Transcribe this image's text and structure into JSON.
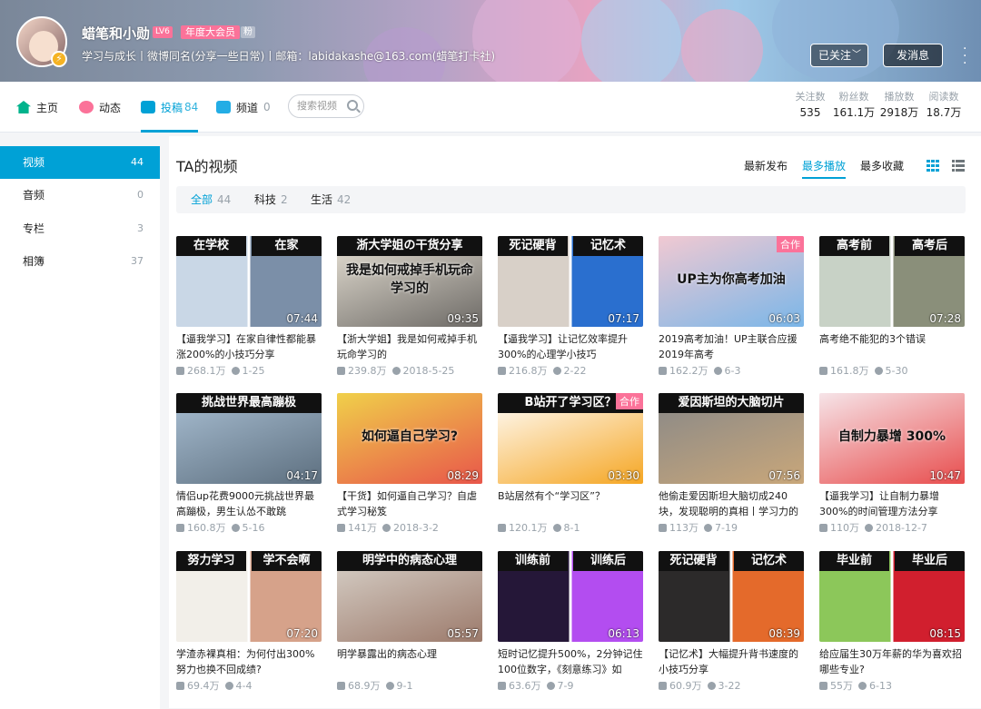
{
  "profile": {
    "name": "蜡笔和小勋",
    "level": "LV6",
    "vip": "年度大会员",
    "fan_tag": "粉",
    "sign": "学习与成长丨微博同名(分享一些日常)丨邮箱：labidakashe@163.com(蜡笔打卡社)",
    "follow_label": "已关注",
    "msg_label": "发消息"
  },
  "nav": {
    "home": "主页",
    "dynamic": "动态",
    "upload": "投稿",
    "upload_count": "84",
    "channel": "频道",
    "channel_count": "0",
    "search_placeholder": "搜索视频"
  },
  "stats": [
    {
      "label": "关注数",
      "value": "535"
    },
    {
      "label": "粉丝数",
      "value": "161.1万"
    },
    {
      "label": "播放数",
      "value": "2918万"
    },
    {
      "label": "阅读数",
      "value": "18.7万"
    }
  ],
  "sidebar": [
    {
      "label": "视频",
      "count": "44"
    },
    {
      "label": "音频",
      "count": "0"
    },
    {
      "label": "专栏",
      "count": "3"
    },
    {
      "label": "相簿",
      "count": "37"
    }
  ],
  "section_title": "TA的视频",
  "sort": [
    "最新发布",
    "最多播放",
    "最多收藏"
  ],
  "filters": [
    {
      "label": "全部",
      "count": "44"
    },
    {
      "label": "科技",
      "count": "2"
    },
    {
      "label": "生活",
      "count": "42"
    }
  ],
  "videos": [
    {
      "cap_l": "在学校",
      "cap_r": "在家",
      "dur": "07:44",
      "title": "【逼我学习】在家自律性都能暴涨200%的小技巧分享",
      "plays": "268.1万",
      "date": "1-25"
    },
    {
      "cap": "浙大学姐の干货分享",
      "sub": "我是如何戒掉手机玩命学习的",
      "dur": "09:35",
      "title": "【浙大学姐】我是如何戒掉手机玩命学习的",
      "plays": "239.8万",
      "date": "2018-5-25"
    },
    {
      "cap_l": "死记硬背",
      "cap_r": "记忆术",
      "dur": "07:17",
      "title": "【逼我学习】让记忆效率提升300%的心理学小技巧",
      "plays": "216.8万",
      "date": "2-22"
    },
    {
      "tag": "合作",
      "sub": "UP主为你高考加油",
      "dur": "06:03",
      "title": "2019高考加油！UP主联合应援2019年高考",
      "plays": "162.2万",
      "date": "6-3"
    },
    {
      "cap_l": "高考前",
      "cap_r": "高考后",
      "dur": "07:28",
      "title": "高考绝不能犯的3个错误",
      "plays": "161.8万",
      "date": "5-30"
    },
    {
      "cap": "挑战世界最高蹦极",
      "dur": "04:17",
      "title": "情侣up花费9000元挑战世界最高蹦极，男生认怂不敢跳",
      "plays": "160.8万",
      "date": "5-16"
    },
    {
      "sub": "如何逼自己学习?",
      "dur": "08:29",
      "title": "【干货】如何逼自己学习？自虐式学习秘笈",
      "plays": "141万",
      "date": "2018-3-2"
    },
    {
      "cap": "B站开了学习区？",
      "tag": "合作",
      "dur": "03:30",
      "title": "B站居然有个“学习区”？",
      "plays": "120.1万",
      "date": "8-1"
    },
    {
      "cap": "爱因斯坦的大脑切片",
      "dur": "07:56",
      "title": "他偷走爱因斯坦大脑切成240块，发现聪明的真相丨学习力的",
      "plays": "113万",
      "date": "7-19"
    },
    {
      "sub": "自制力暴增 300%",
      "dur": "10:47",
      "title": "【逼我学习】让自制力暴增300%的时间管理方法分享",
      "plays": "110万",
      "date": "2018-12-7"
    },
    {
      "cap_l": "努力学习",
      "cap_r": "学不会啊",
      "dur": "07:20",
      "title": "学渣赤裸真相：为何付出300%努力也换不回成绩?",
      "plays": "69.4万",
      "date": "4-4"
    },
    {
      "cap": "明学中的病态心理",
      "dur": "05:57",
      "title": "明学暴露出的病态心理",
      "plays": "68.9万",
      "date": "9-1"
    },
    {
      "cap_l": "训练前",
      "cap_r": "训练后",
      "dur": "06:13",
      "title": "短时记忆提升500%，2分钟记住100位数字，《刻意练习》如",
      "plays": "63.6万",
      "date": "7-9"
    },
    {
      "cap_l": "死记硬背",
      "cap_r": "记忆术",
      "dur": "08:39",
      "title": "【记忆术】大幅提升背书速度的小技巧分享",
      "plays": "60.9万",
      "date": "3-22"
    },
    {
      "cap_l": "毕业前",
      "cap_r": "毕业后",
      "dur": "08:15",
      "title": "给应届生30万年薪的华为喜欢招哪些专业?",
      "plays": "55万",
      "date": "6-13"
    }
  ]
}
